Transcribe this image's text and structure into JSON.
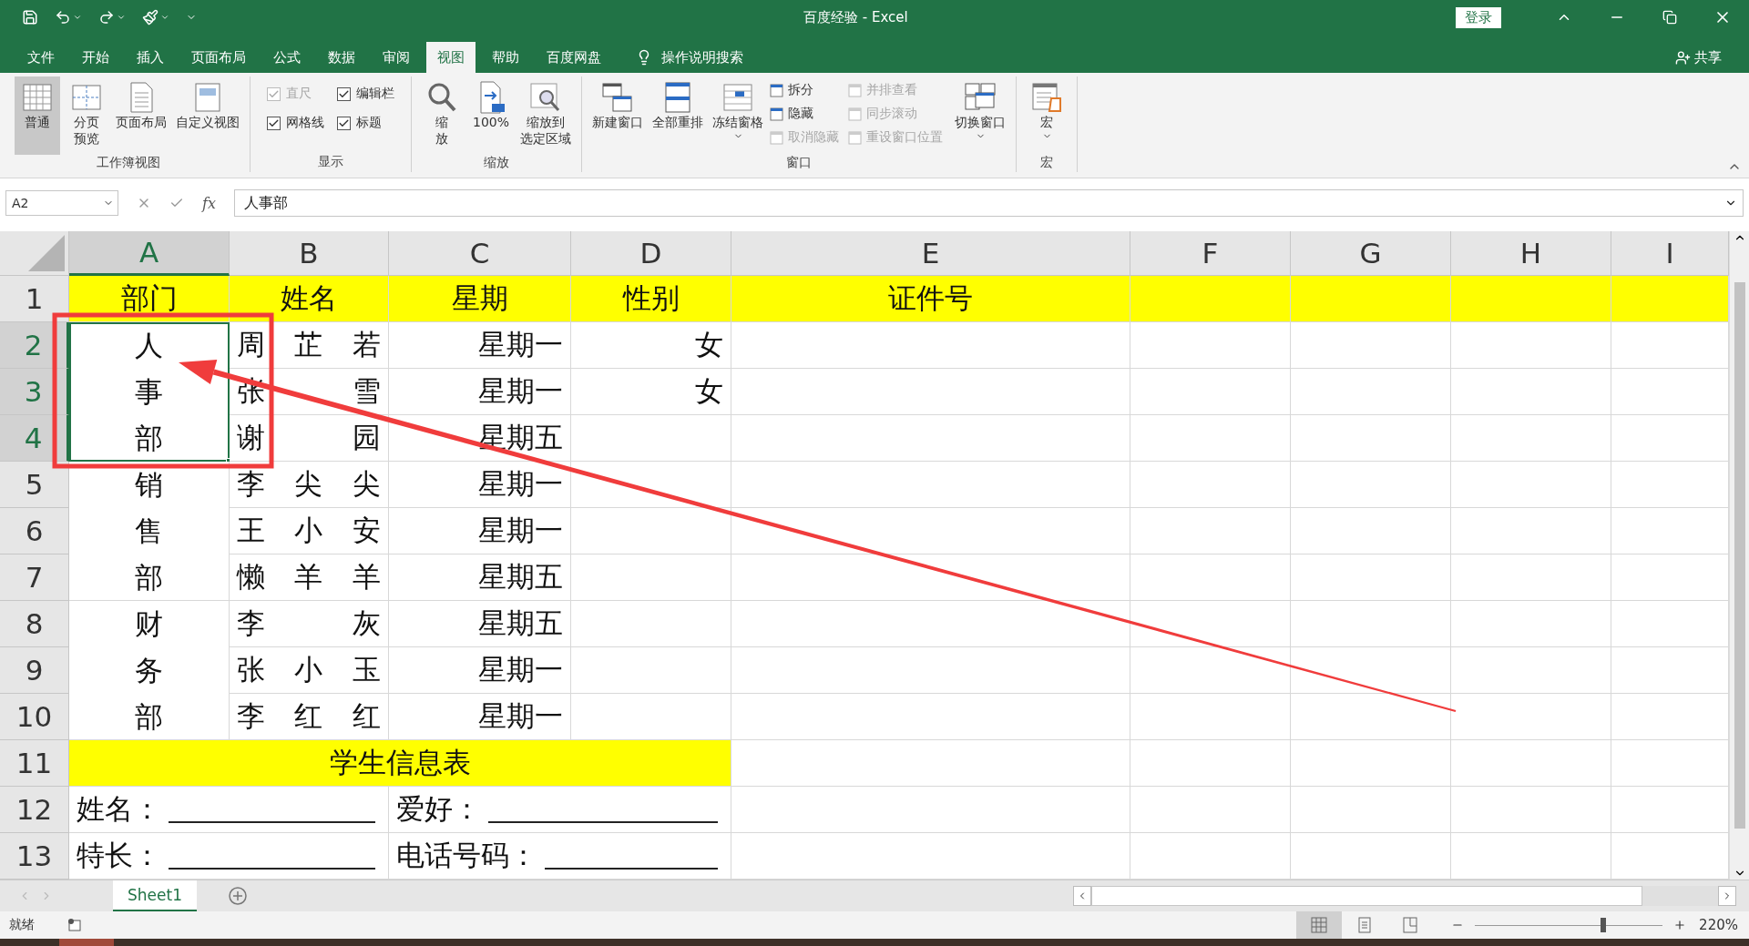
{
  "window": {
    "title": "百度经验 - Excel",
    "login": "登录"
  },
  "tabs": [
    {
      "label": "文件",
      "selected": false
    },
    {
      "label": "开始",
      "selected": false
    },
    {
      "label": "插入",
      "selected": false
    },
    {
      "label": "页面布局",
      "selected": false
    },
    {
      "label": "公式",
      "selected": false
    },
    {
      "label": "数据",
      "selected": false
    },
    {
      "label": "审阅",
      "selected": false
    },
    {
      "label": "视图",
      "selected": true
    },
    {
      "label": "帮助",
      "selected": false
    },
    {
      "label": "百度网盘",
      "selected": false
    }
  ],
  "tell_me": "操作说明搜索",
  "share": "共享",
  "ribbon": {
    "groups": [
      {
        "label": "工作簿视图",
        "items": [
          {
            "kind": "large",
            "label": "普通",
            "selected": true,
            "dropdown": false
          },
          {
            "kind": "large",
            "lines": [
              "分页",
              "预览"
            ],
            "selected": false,
            "dropdown": false
          },
          {
            "kind": "large",
            "label": "页面布局",
            "selected": false,
            "dropdown": false
          },
          {
            "kind": "large",
            "label": "自定义视图",
            "selected": false,
            "dropdown": false
          }
        ]
      },
      {
        "label": "显示",
        "items": [
          {
            "kind": "check",
            "label": "直尺",
            "checked": true,
            "disabled": true
          },
          {
            "kind": "check",
            "label": "编辑栏",
            "checked": true,
            "disabled": false
          },
          {
            "kind": "check",
            "label": "网格线",
            "checked": true,
            "disabled": false
          },
          {
            "kind": "check",
            "label": "标题",
            "checked": true,
            "disabled": false
          }
        ]
      },
      {
        "label": "缩放",
        "items": [
          {
            "kind": "large",
            "lines": [
              "缩",
              "放"
            ],
            "dropdown": false
          },
          {
            "kind": "large",
            "label": "100%",
            "dropdown": false
          },
          {
            "kind": "large",
            "lines": [
              "缩放到",
              "选定区域"
            ],
            "dropdown": false
          }
        ]
      },
      {
        "label": "窗口",
        "items": [
          {
            "kind": "large",
            "label": "新建窗口",
            "dropdown": false
          },
          {
            "kind": "large",
            "label": "全部重排",
            "dropdown": false
          },
          {
            "kind": "large",
            "label": "冻结窗格",
            "dropdown": true
          },
          {
            "kind": "small",
            "label": "拆分",
            "disabled": false
          },
          {
            "kind": "small",
            "label": "隐藏",
            "disabled": false
          },
          {
            "kind": "small",
            "label": "取消隐藏",
            "disabled": true
          },
          {
            "kind": "small",
            "label": "并排查看",
            "disabled": true
          },
          {
            "kind": "small",
            "label": "同步滚动",
            "disabled": true
          },
          {
            "kind": "small",
            "label": "重设窗口位置",
            "disabled": true
          },
          {
            "kind": "large",
            "label": "切换窗口",
            "dropdown": true
          }
        ]
      },
      {
        "label": "宏",
        "items": [
          {
            "kind": "large",
            "label": "宏",
            "dropdown": true
          }
        ]
      }
    ]
  },
  "formula_bar": {
    "name_box": "A2",
    "fx": "fx",
    "value": "人事部"
  },
  "columns": [
    {
      "label": "A",
      "selected": true
    },
    {
      "label": "B",
      "selected": false
    },
    {
      "label": "C",
      "selected": false
    },
    {
      "label": "D",
      "selected": false
    },
    {
      "label": "E",
      "selected": false
    },
    {
      "label": "F",
      "selected": false
    },
    {
      "label": "G",
      "selected": false
    },
    {
      "label": "H",
      "selected": false
    },
    {
      "label": "I",
      "selected": false
    }
  ],
  "rows": [
    {
      "label": "1",
      "selected": false
    },
    {
      "label": "2",
      "selected": true
    },
    {
      "label": "3",
      "selected": true
    },
    {
      "label": "4",
      "selected": true
    },
    {
      "label": "5",
      "selected": false
    },
    {
      "label": "6",
      "selected": false
    },
    {
      "label": "7",
      "selected": false
    },
    {
      "label": "8",
      "selected": false
    },
    {
      "label": "9",
      "selected": false
    },
    {
      "label": "10",
      "selected": false
    },
    {
      "label": "11",
      "selected": false
    },
    {
      "label": "12",
      "selected": false
    },
    {
      "label": "13",
      "selected": false
    }
  ],
  "header_row": [
    "部门",
    "姓名",
    "星期",
    "性别",
    "证件号"
  ],
  "departments": [
    {
      "text": "人事部",
      "selected": true
    },
    {
      "text": "销售部",
      "selected": false
    },
    {
      "text": "财务部",
      "selected": false
    }
  ],
  "records": [
    {
      "name": "周 芷 若",
      "weekday": "星期一",
      "gender": "女"
    },
    {
      "name": "张 雪",
      "weekday": "星期一",
      "gender": "女"
    },
    {
      "name": "谢 园",
      "weekday": "星期五"
    },
    {
      "name": "李 尖 尖",
      "weekday": "星期一"
    },
    {
      "name": "王 小 安",
      "weekday": "星期一"
    },
    {
      "name": "懒 羊 羊",
      "weekday": "星期五"
    },
    {
      "name": "李 灰",
      "weekday": "星期五"
    },
    {
      "name": "张 小 玉",
      "weekday": "星期一"
    },
    {
      "name": "李 红 红",
      "weekday": "星期一"
    }
  ],
  "form_title": "学生信息表",
  "form_fields": [
    {
      "label": "姓名："
    },
    {
      "label": "爱好："
    },
    {
      "label": "特长："
    },
    {
      "label": "电话号码："
    }
  ],
  "sheet_tabs": [
    {
      "label": "Sheet1",
      "selected": true
    }
  ],
  "status": {
    "text": "就绪",
    "views": [
      {
        "selected": true
      },
      {
        "selected": false
      },
      {
        "selected": false
      }
    ],
    "zoom_slider": {
      "level": 0.69
    },
    "zoom": "220%"
  }
}
